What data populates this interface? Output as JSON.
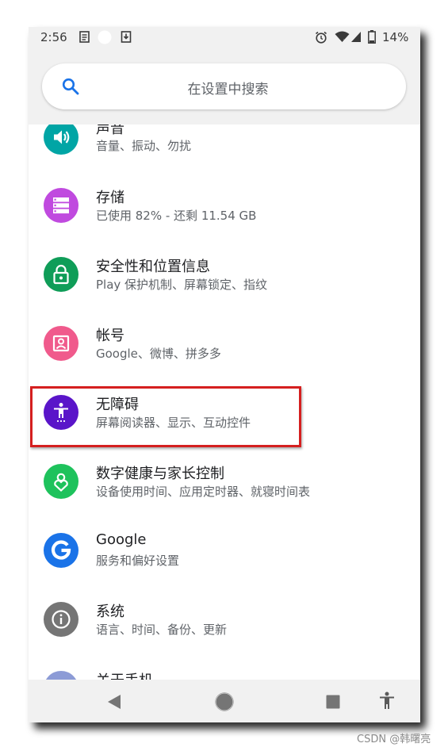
{
  "status_bar": {
    "time": "2:56",
    "battery": "14%",
    "icons": [
      "notes-icon",
      "circle-icon",
      "download-icon",
      "alarm-icon",
      "wifi-icon",
      "signal-icon",
      "battery-icon"
    ]
  },
  "search": {
    "placeholder": "在设置中搜索",
    "icon": "search-icon"
  },
  "settings_items": [
    {
      "title": "声音",
      "subtitle": "音量、振动、勿扰",
      "color": "#00a5a5",
      "icon": "volume-icon"
    },
    {
      "title": "存储",
      "subtitle": "已使用 82% - 还剩 11.54 GB",
      "color": "#c04adf",
      "icon": "storage-icon"
    },
    {
      "title": "安全性和位置信息",
      "subtitle": "Play 保护机制、屏幕锁定、指纹",
      "color": "#0f9d58",
      "icon": "lock-icon"
    },
    {
      "title": "帐号",
      "subtitle": "Google、微博、拼多多",
      "color": "#f05a8c",
      "icon": "account-icon"
    },
    {
      "title": "无障碍",
      "subtitle": "屏幕阅读器、显示、互动控件",
      "color": "#5a15c9",
      "icon": "accessibility-icon"
    },
    {
      "title": "数字健康与家长控制",
      "subtitle": "设备使用时间、应用定时器、就寝时间表",
      "color": "#1ec25c",
      "icon": "digital-wellbeing-icon"
    },
    {
      "title": "Google",
      "subtitle": "服务和偏好设置",
      "color": "#1a73e8",
      "icon": "google-icon"
    },
    {
      "title": "系统",
      "subtitle": "语言、时间、备份、更新",
      "color": "#757575",
      "icon": "info-icon"
    },
    {
      "title": "关于手机",
      "subtitle": "",
      "color": "#8c9bd6",
      "icon": "phone-icon"
    }
  ],
  "nav_bar": {
    "icons": [
      "back-icon",
      "home-icon",
      "recents-icon",
      "accessibility-shortcut-icon"
    ]
  },
  "watermark": "CSDN @韩曙亮",
  "highlight_color": "#d51f1f"
}
